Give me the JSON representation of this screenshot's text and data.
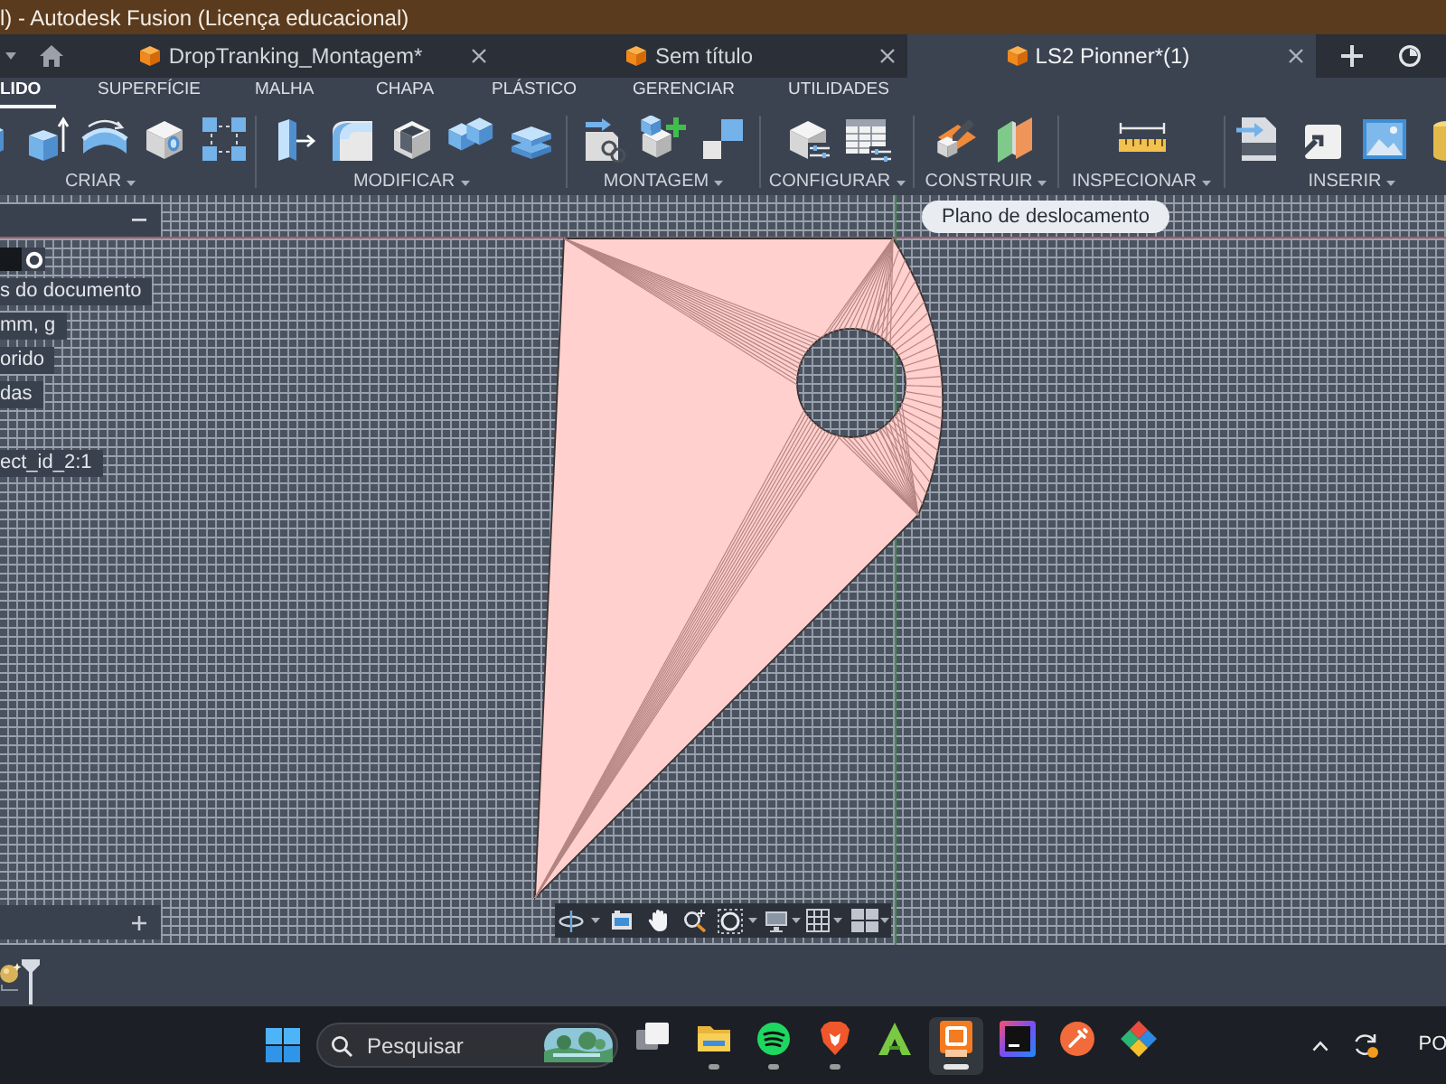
{
  "window": {
    "title": "l) - Autodesk Fusion (Licença educacional)"
  },
  "document_tabs": [
    {
      "label": "DropTranking_Montagem*",
      "selected": false
    },
    {
      "label": "Sem título",
      "selected": false
    },
    {
      "label": "LS2 Pionner*(1)",
      "selected": true
    }
  ],
  "ribbon_tabs": [
    {
      "label": "LIDO",
      "selected": true
    },
    {
      "label": "SUPERFÍCIE",
      "selected": false
    },
    {
      "label": "MALHA",
      "selected": false
    },
    {
      "label": "CHAPA",
      "selected": false
    },
    {
      "label": "PLÁSTICO",
      "selected": false
    },
    {
      "label": "GERENCIAR",
      "selected": false
    },
    {
      "label": "UTILIDADES",
      "selected": false
    }
  ],
  "toolbar_groups": [
    {
      "label": "CRIAR"
    },
    {
      "label": "MODIFICAR"
    },
    {
      "label": "MONTAGEM"
    },
    {
      "label": "CONFIGURAR"
    },
    {
      "label": "CONSTRUIR"
    },
    {
      "label": "INSPECIONAR"
    },
    {
      "label": "INSERIR"
    }
  ],
  "tooltip": {
    "text": "Plano de deslocamento"
  },
  "browser": {
    "items": [
      {
        "label": "s do documento"
      },
      {
        "label": "mm, g"
      },
      {
        "label": "orido"
      },
      {
        "label": "das"
      },
      {
        "label": "ect_id_2:1"
      }
    ]
  },
  "taskbar": {
    "search": {
      "placeholder": "Pesquisar"
    },
    "apps": [
      {
        "kind": "taskview",
        "running": false,
        "selected": false
      },
      {
        "kind": "folder",
        "running": true,
        "selected": false
      },
      {
        "kind": "music",
        "running": true,
        "selected": false
      },
      {
        "kind": "shield",
        "running": true,
        "selected": false
      },
      {
        "kind": "peak",
        "running": false,
        "selected": false
      },
      {
        "kind": "tile",
        "running": true,
        "selected": true
      },
      {
        "kind": "ide",
        "running": false,
        "selected": false
      },
      {
        "kind": "orb",
        "running": false,
        "selected": false
      },
      {
        "kind": "diamond",
        "running": false,
        "selected": false
      }
    ],
    "language": "PO"
  }
}
